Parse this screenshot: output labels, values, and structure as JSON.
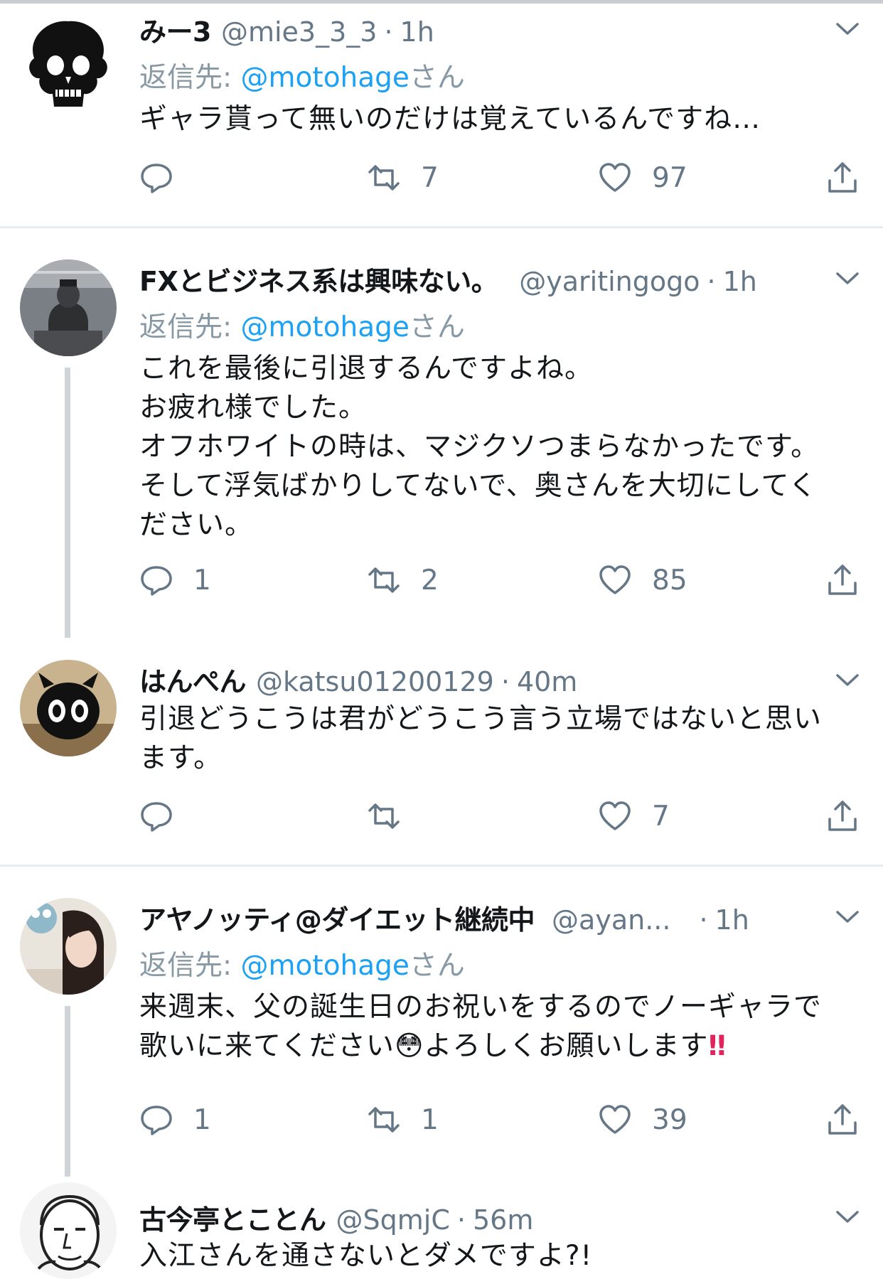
{
  "reply_prefix": "返信先:",
  "reply_suffix": "さん",
  "tweets": [
    {
      "name": "みー3",
      "handle": "@mie3_3_3",
      "time": "1h",
      "reply_to": "@motohage",
      "text": "ギャラ貰って無いのだけは覚えているんですね…",
      "replies": "",
      "retweets": "7",
      "likes": "97"
    },
    {
      "name": "FXとビジネス系は興味ない。",
      "handle": "@yaritingogo",
      "time": "1h",
      "reply_to": "@motohage",
      "text": "これを最後に引退するんですよね。\nお疲れ様でした。\nオフホワイトの時は、マジクソつまらなかったです。\nそして浮気ばかりしてないで、奥さんを大切にしてく\nださい。",
      "replies": "1",
      "retweets": "2",
      "likes": "85"
    },
    {
      "name": "はんぺん",
      "handle": "@katsu01200129",
      "time": "40m",
      "text": "引退どうこうは君がどうこう言う立場ではないと思い\nます。",
      "replies": "",
      "retweets": "",
      "likes": "7"
    },
    {
      "name": "アヤノッティ@ダイエット継続中",
      "handle": "@ayan...",
      "time": "1h",
      "reply_to": "@motohage",
      "text_line1": "来週末、父の誕生日のお祝いをするのでノーギャラで",
      "text_line2a": "歌いに来てください",
      "emoji": "😳",
      "text_line2b": "よろしくお願いします",
      "text_line2c": "‼",
      "replies": "1",
      "retweets": "1",
      "likes": "39"
    },
    {
      "name": "古今亭とことん",
      "handle": "@SqmjC",
      "time": "56m",
      "text": "入江さんを通さないとダメですよ?!"
    }
  ],
  "colors": {
    "link": "#1da1f2",
    "meta": "#657786",
    "divider": "#e6ecf0",
    "thread": "#cfd4d8"
  }
}
